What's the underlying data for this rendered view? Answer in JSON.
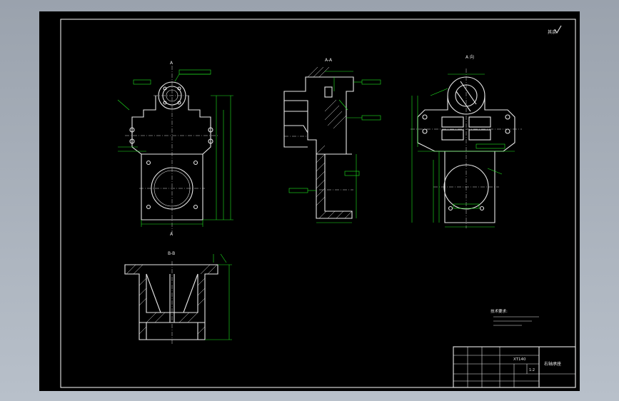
{
  "drawing": {
    "view_titles": {
      "section_aa": "A-A",
      "view_a": "A 向",
      "section_bb": "B-B"
    },
    "cutting_plane_label": "A",
    "roughness_note": "其余",
    "title_block": {
      "drawing_number": "XT140",
      "part_name": "右轴承座",
      "scale": "1:2"
    },
    "technical_requirements": {
      "heading": "技术要求:"
    }
  }
}
